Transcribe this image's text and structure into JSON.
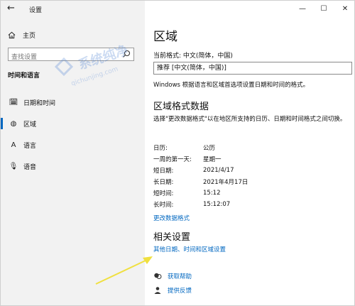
{
  "window": {
    "title": "设置",
    "controls": [
      "—",
      "☐",
      "✕"
    ]
  },
  "sidebar": {
    "home_label": "主页",
    "search_placeholder": "查找设置",
    "section_title": "时间和语言",
    "items": [
      {
        "label": "日期和时间",
        "icon": "calendar-clock-icon",
        "glyph": "🗓"
      },
      {
        "label": "区域",
        "icon": "globe-icon",
        "glyph": "◍",
        "active": true
      },
      {
        "label": "语言",
        "icon": "language-icon",
        "glyph": "A"
      },
      {
        "label": "语音",
        "icon": "microphone-icon",
        "glyph": "🎙"
      }
    ]
  },
  "main": {
    "title": "区域",
    "current_format_label": "当前格式: 中文(简体，中国)",
    "format_dropdown_value": "推荐 [中文(简体，中国)]",
    "info_text": "Windows 根据语言和区域首选项设置日期和时间的格式。",
    "region_data_title": "区域格式数据",
    "region_data_desc": "选择\"更改数据格式\"以在地区所支持的日历、日期和时间格式之间切换。",
    "rows": [
      {
        "k": "日历:",
        "v": "公历"
      },
      {
        "k": "一周的第一天:",
        "v": "星期一"
      },
      {
        "k": "短日期:",
        "v": "2021/4/17"
      },
      {
        "k": "长日期:",
        "v": "2021年4月17日"
      },
      {
        "k": "短时间:",
        "v": "15:12"
      },
      {
        "k": "长时间:",
        "v": "15:12:07"
      }
    ],
    "change_format_link": "更改数据格式",
    "related_title": "相关设置",
    "related_link": "其他日期、时间和区域设置",
    "help_label": "获取帮助",
    "feedback_label": "提供反馈"
  },
  "watermark": {
    "text": "系统纯净",
    "url": "qichunjing.com"
  },
  "colors": {
    "accent": "#0067c0",
    "sidebar_bg": "#f2f2f2",
    "annotation_arrow": "#f0e040"
  }
}
